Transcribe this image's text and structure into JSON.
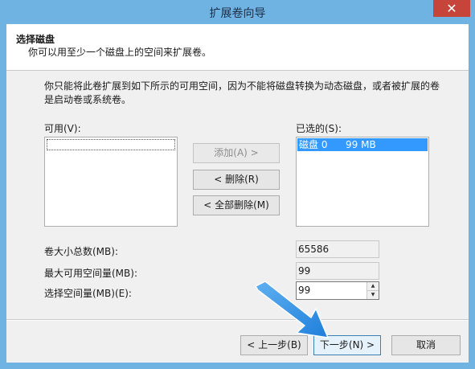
{
  "window": {
    "title": "扩展卷向导",
    "close_glyph": "✕"
  },
  "header": {
    "title": "选择磁盘",
    "subtitle": "你可以用至少一个磁盘上的空间来扩展卷。"
  },
  "description": {
    "line1": "你只能将此卷扩展到如下所示的可用空间，因为不能将磁盘转换为动态磁盘，或者被扩展的卷",
    "line2": "是启动卷或系统卷。"
  },
  "available": {
    "label": "可用(V):",
    "items": []
  },
  "selected": {
    "label": "已选的(S):",
    "items": [
      {
        "disk": "磁盘 0",
        "size": "99 MB"
      }
    ]
  },
  "buttons": {
    "add": "添加(A) >",
    "remove": "< 删除(R)",
    "remove_all": "< 全部删除(M)"
  },
  "fields": {
    "total_label": "卷大小总数(MB):",
    "total_value": "65586",
    "max_label": "最大可用空间量(MB):",
    "max_value": "99",
    "select_label": "选择空间量(MB)(E):",
    "select_value": "99"
  },
  "footer": {
    "back": "< 上一步(B)",
    "next": "下一步(N) >",
    "cancel": "取消"
  },
  "colors": {
    "title_bar": "#6fb3e3",
    "selection": "#3399ff",
    "arrow": "#2b8be6"
  }
}
